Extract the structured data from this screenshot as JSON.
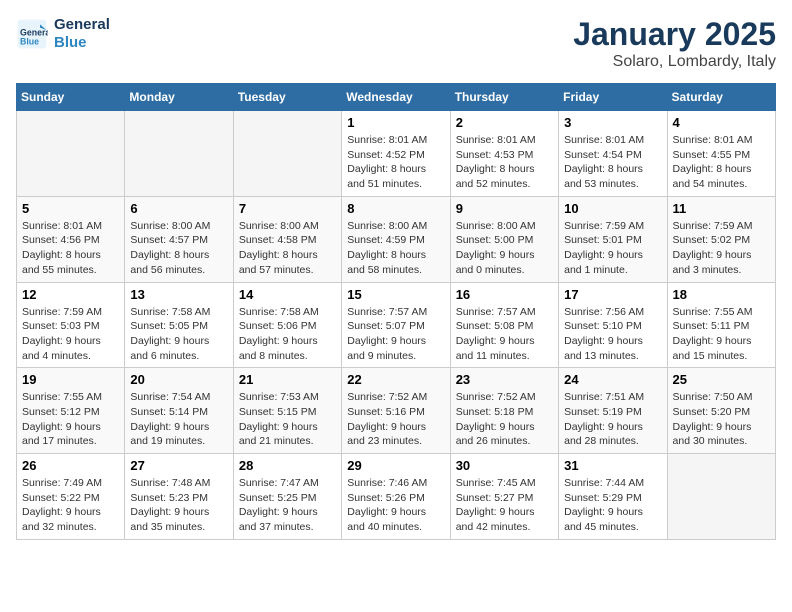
{
  "header": {
    "logo_line1": "General",
    "logo_line2": "Blue",
    "title": "January 2025",
    "subtitle": "Solaro, Lombardy, Italy"
  },
  "weekdays": [
    "Sunday",
    "Monday",
    "Tuesday",
    "Wednesday",
    "Thursday",
    "Friday",
    "Saturday"
  ],
  "weeks": [
    [
      {
        "day": "",
        "empty": true
      },
      {
        "day": "",
        "empty": true
      },
      {
        "day": "",
        "empty": true
      },
      {
        "day": "1",
        "sunrise": "8:01 AM",
        "sunset": "4:52 PM",
        "daylight": "8 hours and 51 minutes."
      },
      {
        "day": "2",
        "sunrise": "8:01 AM",
        "sunset": "4:53 PM",
        "daylight": "8 hours and 52 minutes."
      },
      {
        "day": "3",
        "sunrise": "8:01 AM",
        "sunset": "4:54 PM",
        "daylight": "8 hours and 53 minutes."
      },
      {
        "day": "4",
        "sunrise": "8:01 AM",
        "sunset": "4:55 PM",
        "daylight": "8 hours and 54 minutes."
      }
    ],
    [
      {
        "day": "5",
        "sunrise": "8:01 AM",
        "sunset": "4:56 PM",
        "daylight": "8 hours and 55 minutes."
      },
      {
        "day": "6",
        "sunrise": "8:00 AM",
        "sunset": "4:57 PM",
        "daylight": "8 hours and 56 minutes."
      },
      {
        "day": "7",
        "sunrise": "8:00 AM",
        "sunset": "4:58 PM",
        "daylight": "8 hours and 57 minutes."
      },
      {
        "day": "8",
        "sunrise": "8:00 AM",
        "sunset": "4:59 PM",
        "daylight": "8 hours and 58 minutes."
      },
      {
        "day": "9",
        "sunrise": "8:00 AM",
        "sunset": "5:00 PM",
        "daylight": "9 hours and 0 minutes."
      },
      {
        "day": "10",
        "sunrise": "7:59 AM",
        "sunset": "5:01 PM",
        "daylight": "9 hours and 1 minute."
      },
      {
        "day": "11",
        "sunrise": "7:59 AM",
        "sunset": "5:02 PM",
        "daylight": "9 hours and 3 minutes."
      }
    ],
    [
      {
        "day": "12",
        "sunrise": "7:59 AM",
        "sunset": "5:03 PM",
        "daylight": "9 hours and 4 minutes."
      },
      {
        "day": "13",
        "sunrise": "7:58 AM",
        "sunset": "5:05 PM",
        "daylight": "9 hours and 6 minutes."
      },
      {
        "day": "14",
        "sunrise": "7:58 AM",
        "sunset": "5:06 PM",
        "daylight": "9 hours and 8 minutes."
      },
      {
        "day": "15",
        "sunrise": "7:57 AM",
        "sunset": "5:07 PM",
        "daylight": "9 hours and 9 minutes."
      },
      {
        "day": "16",
        "sunrise": "7:57 AM",
        "sunset": "5:08 PM",
        "daylight": "9 hours and 11 minutes."
      },
      {
        "day": "17",
        "sunrise": "7:56 AM",
        "sunset": "5:10 PM",
        "daylight": "9 hours and 13 minutes."
      },
      {
        "day": "18",
        "sunrise": "7:55 AM",
        "sunset": "5:11 PM",
        "daylight": "9 hours and 15 minutes."
      }
    ],
    [
      {
        "day": "19",
        "sunrise": "7:55 AM",
        "sunset": "5:12 PM",
        "daylight": "9 hours and 17 minutes."
      },
      {
        "day": "20",
        "sunrise": "7:54 AM",
        "sunset": "5:14 PM",
        "daylight": "9 hours and 19 minutes."
      },
      {
        "day": "21",
        "sunrise": "7:53 AM",
        "sunset": "5:15 PM",
        "daylight": "9 hours and 21 minutes."
      },
      {
        "day": "22",
        "sunrise": "7:52 AM",
        "sunset": "5:16 PM",
        "daylight": "9 hours and 23 minutes."
      },
      {
        "day": "23",
        "sunrise": "7:52 AM",
        "sunset": "5:18 PM",
        "daylight": "9 hours and 26 minutes."
      },
      {
        "day": "24",
        "sunrise": "7:51 AM",
        "sunset": "5:19 PM",
        "daylight": "9 hours and 28 minutes."
      },
      {
        "day": "25",
        "sunrise": "7:50 AM",
        "sunset": "5:20 PM",
        "daylight": "9 hours and 30 minutes."
      }
    ],
    [
      {
        "day": "26",
        "sunrise": "7:49 AM",
        "sunset": "5:22 PM",
        "daylight": "9 hours and 32 minutes."
      },
      {
        "day": "27",
        "sunrise": "7:48 AM",
        "sunset": "5:23 PM",
        "daylight": "9 hours and 35 minutes."
      },
      {
        "day": "28",
        "sunrise": "7:47 AM",
        "sunset": "5:25 PM",
        "daylight": "9 hours and 37 minutes."
      },
      {
        "day": "29",
        "sunrise": "7:46 AM",
        "sunset": "5:26 PM",
        "daylight": "9 hours and 40 minutes."
      },
      {
        "day": "30",
        "sunrise": "7:45 AM",
        "sunset": "5:27 PM",
        "daylight": "9 hours and 42 minutes."
      },
      {
        "day": "31",
        "sunrise": "7:44 AM",
        "sunset": "5:29 PM",
        "daylight": "9 hours and 45 minutes."
      },
      {
        "day": "",
        "empty": true
      }
    ]
  ],
  "labels": {
    "sunrise": "Sunrise:",
    "sunset": "Sunset:",
    "daylight": "Daylight:"
  }
}
